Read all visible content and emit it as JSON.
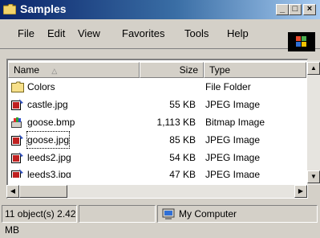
{
  "window": {
    "title": "Samples"
  },
  "menu": [
    "File",
    "Edit",
    "View",
    "Favorites",
    "Tools",
    "Help"
  ],
  "columns": {
    "name": "Name",
    "size": "Size",
    "type": "Type"
  },
  "files": [
    {
      "name": "Colors",
      "size": "",
      "type": "File Folder",
      "icon": "folder-icon"
    },
    {
      "name": "castle.jpg",
      "size": "55 KB",
      "type": "JPEG Image",
      "icon": "jpeg-icon"
    },
    {
      "name": "goose.bmp",
      "size": "1,113 KB",
      "type": "Bitmap Image",
      "icon": "bitmap-icon"
    },
    {
      "name": "goose.jpg",
      "size": "85 KB",
      "type": "JPEG Image",
      "icon": "jpeg-icon"
    },
    {
      "name": "leeds2.jpg",
      "size": "54 KB",
      "type": "JPEG Image",
      "icon": "jpeg-icon"
    },
    {
      "name": "leeds3.jpg",
      "size": "47 KB",
      "type": "JPEG Image",
      "icon": "jpeg-icon"
    }
  ],
  "status": {
    "count": "11 object(s)",
    "size": "2.42 MB",
    "zone": "My Computer"
  },
  "colors": {
    "title_bar": "#0a246a",
    "face": "#d4d0c8"
  }
}
